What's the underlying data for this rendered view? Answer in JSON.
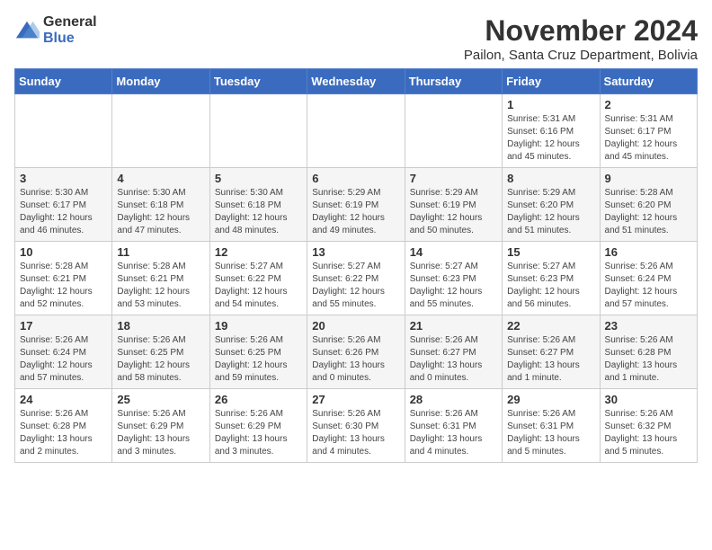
{
  "logo": {
    "general": "General",
    "blue": "Blue"
  },
  "title": "November 2024",
  "subtitle": "Pailon, Santa Cruz Department, Bolivia",
  "weekdays": [
    "Sunday",
    "Monday",
    "Tuesday",
    "Wednesday",
    "Thursday",
    "Friday",
    "Saturday"
  ],
  "weeks": [
    [
      {
        "day": "",
        "info": ""
      },
      {
        "day": "",
        "info": ""
      },
      {
        "day": "",
        "info": ""
      },
      {
        "day": "",
        "info": ""
      },
      {
        "day": "",
        "info": ""
      },
      {
        "day": "1",
        "info": "Sunrise: 5:31 AM\nSunset: 6:16 PM\nDaylight: 12 hours\nand 45 minutes."
      },
      {
        "day": "2",
        "info": "Sunrise: 5:31 AM\nSunset: 6:17 PM\nDaylight: 12 hours\nand 45 minutes."
      }
    ],
    [
      {
        "day": "3",
        "info": "Sunrise: 5:30 AM\nSunset: 6:17 PM\nDaylight: 12 hours\nand 46 minutes."
      },
      {
        "day": "4",
        "info": "Sunrise: 5:30 AM\nSunset: 6:18 PM\nDaylight: 12 hours\nand 47 minutes."
      },
      {
        "day": "5",
        "info": "Sunrise: 5:30 AM\nSunset: 6:18 PM\nDaylight: 12 hours\nand 48 minutes."
      },
      {
        "day": "6",
        "info": "Sunrise: 5:29 AM\nSunset: 6:19 PM\nDaylight: 12 hours\nand 49 minutes."
      },
      {
        "day": "7",
        "info": "Sunrise: 5:29 AM\nSunset: 6:19 PM\nDaylight: 12 hours\nand 50 minutes."
      },
      {
        "day": "8",
        "info": "Sunrise: 5:29 AM\nSunset: 6:20 PM\nDaylight: 12 hours\nand 51 minutes."
      },
      {
        "day": "9",
        "info": "Sunrise: 5:28 AM\nSunset: 6:20 PM\nDaylight: 12 hours\nand 51 minutes."
      }
    ],
    [
      {
        "day": "10",
        "info": "Sunrise: 5:28 AM\nSunset: 6:21 PM\nDaylight: 12 hours\nand 52 minutes."
      },
      {
        "day": "11",
        "info": "Sunrise: 5:28 AM\nSunset: 6:21 PM\nDaylight: 12 hours\nand 53 minutes."
      },
      {
        "day": "12",
        "info": "Sunrise: 5:27 AM\nSunset: 6:22 PM\nDaylight: 12 hours\nand 54 minutes."
      },
      {
        "day": "13",
        "info": "Sunrise: 5:27 AM\nSunset: 6:22 PM\nDaylight: 12 hours\nand 55 minutes."
      },
      {
        "day": "14",
        "info": "Sunrise: 5:27 AM\nSunset: 6:23 PM\nDaylight: 12 hours\nand 55 minutes."
      },
      {
        "day": "15",
        "info": "Sunrise: 5:27 AM\nSunset: 6:23 PM\nDaylight: 12 hours\nand 56 minutes."
      },
      {
        "day": "16",
        "info": "Sunrise: 5:26 AM\nSunset: 6:24 PM\nDaylight: 12 hours\nand 57 minutes."
      }
    ],
    [
      {
        "day": "17",
        "info": "Sunrise: 5:26 AM\nSunset: 6:24 PM\nDaylight: 12 hours\nand 57 minutes."
      },
      {
        "day": "18",
        "info": "Sunrise: 5:26 AM\nSunset: 6:25 PM\nDaylight: 12 hours\nand 58 minutes."
      },
      {
        "day": "19",
        "info": "Sunrise: 5:26 AM\nSunset: 6:25 PM\nDaylight: 12 hours\nand 59 minutes."
      },
      {
        "day": "20",
        "info": "Sunrise: 5:26 AM\nSunset: 6:26 PM\nDaylight: 13 hours\nand 0 minutes."
      },
      {
        "day": "21",
        "info": "Sunrise: 5:26 AM\nSunset: 6:27 PM\nDaylight: 13 hours\nand 0 minutes."
      },
      {
        "day": "22",
        "info": "Sunrise: 5:26 AM\nSunset: 6:27 PM\nDaylight: 13 hours\nand 1 minute."
      },
      {
        "day": "23",
        "info": "Sunrise: 5:26 AM\nSunset: 6:28 PM\nDaylight: 13 hours\nand 1 minute."
      }
    ],
    [
      {
        "day": "24",
        "info": "Sunrise: 5:26 AM\nSunset: 6:28 PM\nDaylight: 13 hours\nand 2 minutes."
      },
      {
        "day": "25",
        "info": "Sunrise: 5:26 AM\nSunset: 6:29 PM\nDaylight: 13 hours\nand 3 minutes."
      },
      {
        "day": "26",
        "info": "Sunrise: 5:26 AM\nSunset: 6:29 PM\nDaylight: 13 hours\nand 3 minutes."
      },
      {
        "day": "27",
        "info": "Sunrise: 5:26 AM\nSunset: 6:30 PM\nDaylight: 13 hours\nand 4 minutes."
      },
      {
        "day": "28",
        "info": "Sunrise: 5:26 AM\nSunset: 6:31 PM\nDaylight: 13 hours\nand 4 minutes."
      },
      {
        "day": "29",
        "info": "Sunrise: 5:26 AM\nSunset: 6:31 PM\nDaylight: 13 hours\nand 5 minutes."
      },
      {
        "day": "30",
        "info": "Sunrise: 5:26 AM\nSunset: 6:32 PM\nDaylight: 13 hours\nand 5 minutes."
      }
    ]
  ]
}
